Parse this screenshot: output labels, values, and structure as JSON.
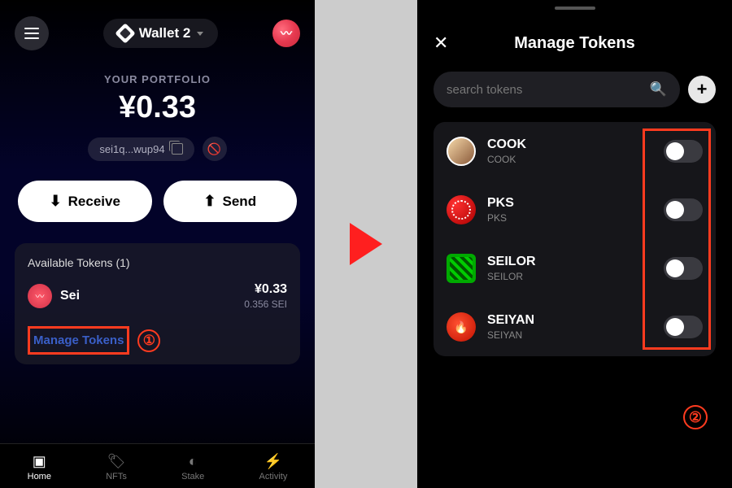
{
  "left": {
    "wallet_name": "Wallet 2",
    "portfolio_label": "YOUR PORTFOLIO",
    "portfolio_value": "¥0.33",
    "address": "sei1q...wup94",
    "receive_label": "Receive",
    "send_label": "Send",
    "available_tokens_header": "Available Tokens (1)",
    "token": {
      "name": "Sei",
      "value": "¥0.33",
      "amount": "0.356 SEI"
    },
    "manage_link": "Manage Tokens",
    "callout": "①",
    "nav": {
      "home": "Home",
      "nfts": "NFTs",
      "stake": "Stake",
      "activity": "Activity"
    }
  },
  "right": {
    "title": "Manage Tokens",
    "search_placeholder": "search tokens",
    "tokens": [
      {
        "symbol": "COOK",
        "name": "COOK"
      },
      {
        "symbol": "PKS",
        "name": "PKS"
      },
      {
        "symbol": "SEILOR",
        "name": "SEILOR"
      },
      {
        "symbol": "SEIYAN",
        "name": "SEIYAN"
      }
    ],
    "callout": "②"
  }
}
